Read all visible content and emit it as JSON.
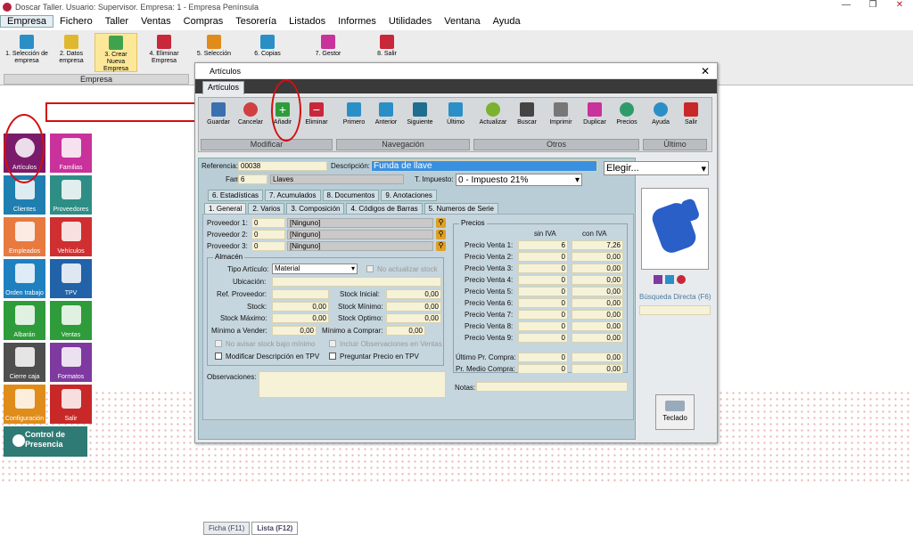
{
  "window": {
    "title": "Doscar Taller. Usuario: Supervisor. Empresa: 1 - Empresa Península",
    "controls": [
      "—",
      "❐",
      "✕"
    ]
  },
  "menu": [
    "Empresa",
    "Fichero",
    "Taller",
    "Ventas",
    "Compras",
    "Tesorería",
    "Listados",
    "Informes",
    "Utilidades",
    "Ventana",
    "Ayuda"
  ],
  "ribbon": {
    "buttons": [
      "1. Selección de empresa",
      "2. Datos empresa",
      "3. Crear Nueva Empresa",
      "4. Eliminar Empresa",
      "5. Selección",
      "6. Copias",
      "7. Gestor",
      "8. Salir"
    ],
    "group_label": "Empresa"
  },
  "tiles": [
    {
      "label": "Artículos",
      "color": "#7b1b6b"
    },
    {
      "label": "Familias",
      "color": "#c9319b"
    },
    {
      "label": "Clientes",
      "color": "#1f7fb0"
    },
    {
      "label": "Proveedores",
      "color": "#2e8e86"
    },
    {
      "label": "Empleados",
      "color": "#e87a40"
    },
    {
      "label": "Vehículos",
      "color": "#cf2f30"
    },
    {
      "label": "Orden trabajo",
      "color": "#1f80c0"
    },
    {
      "label": "TPV",
      "color": "#2162a8"
    },
    {
      "label": "Albarán",
      "color": "#2e9c3a"
    },
    {
      "label": "Ventas",
      "color": "#2e9c3a"
    },
    {
      "label": "Cierre caja",
      "color": "#4f4f4f"
    },
    {
      "label": "Formatos",
      "color": "#7e3aa0"
    },
    {
      "label": "Configuración",
      "color": "#e08c1a"
    },
    {
      "label": "Salir",
      "color": "#c82828"
    }
  ],
  "control_presencia": "Control de Presencia",
  "dialog": {
    "title": "Artículos",
    "tab": "Artículos",
    "buttons": [
      "Guardar",
      "Cancelar",
      "Añadir",
      "Eliminar",
      "Primero",
      "Anterior",
      "Siguiente",
      "Último",
      "Actualizar",
      "Buscar",
      "Imprimir",
      "Duplicar",
      "Precios",
      "Ayuda",
      "Salir"
    ],
    "groups": [
      "Modificar",
      "Navegación",
      "Otros",
      "Último"
    ],
    "referencia_label": "Referencia:",
    "referencia": "00038",
    "descripcion_label": "Descripción:",
    "descripcion": "Funda de llave",
    "familia_label": "Familia:",
    "familia_code": "6",
    "familia_name": "Llaves",
    "impuesto_label": "T. Impuesto:",
    "impuesto": "0 - Impuesto 21%",
    "elegir": "Elegir...",
    "tabs_top": [
      "6. Estadísticas",
      "7. Acumulados",
      "8. Documentos",
      "9. Anotaciones"
    ],
    "tabs_sub": [
      "1. General",
      "2. Varios",
      "3. Composición",
      "4. Códigos de Barras",
      "5. Numeros de Serie"
    ],
    "proveedores": [
      {
        "label": "Proveedor 1:",
        "code": "0",
        "name": "[Ninguno]"
      },
      {
        "label": "Proveedor 2:",
        "code": "0",
        "name": "[Ninguno]"
      },
      {
        "label": "Proveedor 3:",
        "code": "0",
        "name": "[Ninguno]"
      }
    ],
    "almacen": {
      "legend": "Almacén",
      "tipo_label": "Tipo Artículo:",
      "tipo": "Material",
      "no_actualizar": "No actualizar stock",
      "ubicacion": "Ubicación:",
      "ref_proveedor": "Ref. Proveedor:",
      "stock_inicial": "Stock Inicial:",
      "stock_inicial_val": "0,00",
      "stock": "Stock:",
      "stock_val": "0,00",
      "stock_minimo": "Stock Mínimo:",
      "stock_minimo_val": "0,00",
      "stock_maximo": "Stock Máximo:",
      "stock_maximo_val": "0,00",
      "stock_optimo": "Stock Optimo:",
      "stock_optimo_val": "0,00",
      "min_vender": "Mínimo a Vender:",
      "min_vender_val": "0,00",
      "min_comprar": "Mínimo a Comprar:",
      "min_comprar_val": "0,00",
      "no_avisar": "No avisar stock bajo mínimo",
      "incluir_obs": "Incluir Observaciones en Ventas",
      "modificar_desc": "Modificar Descripción en TPV",
      "preguntar_precio": "Preguntar Precio en TPV"
    },
    "observaciones": "Observaciones:",
    "precios": {
      "legend": "Precios",
      "col_sin": "sin IVA",
      "col_con": "con IVA",
      "rows": [
        {
          "label": "Precio Venta 1:",
          "sin": "6",
          "con": "7,26"
        },
        {
          "label": "Precio Venta 2:",
          "sin": "0",
          "con": "0,00"
        },
        {
          "label": "Precio Venta 3:",
          "sin": "0",
          "con": "0,00"
        },
        {
          "label": "Precio Venta 4:",
          "sin": "0",
          "con": "0,00"
        },
        {
          "label": "Precio Venta 5:",
          "sin": "0",
          "con": "0,00"
        },
        {
          "label": "Precio Venta 6:",
          "sin": "0",
          "con": "0,00"
        },
        {
          "label": "Precio Venta 7:",
          "sin": "0",
          "con": "0,00"
        },
        {
          "label": "Precio Venta 8:",
          "sin": "0",
          "con": "0,00"
        },
        {
          "label": "Precio Venta 9:",
          "sin": "0",
          "con": "0,00"
        }
      ],
      "ultimo_compra": "Último Pr. Compra:",
      "ultimo_compra_sin": "0",
      "ultimo_compra_con": "0,00",
      "medio_compra": "Pr. Medio Compra:",
      "medio_compra_sin": "0",
      "medio_compra_con": "0,00",
      "notas": "Notas:"
    },
    "busqueda_directa": "Búsqueda Directa (F6)",
    "teclado": "Teclado",
    "bottom_tabs": [
      "Ficha (F11)",
      "Lista (F12)"
    ]
  }
}
